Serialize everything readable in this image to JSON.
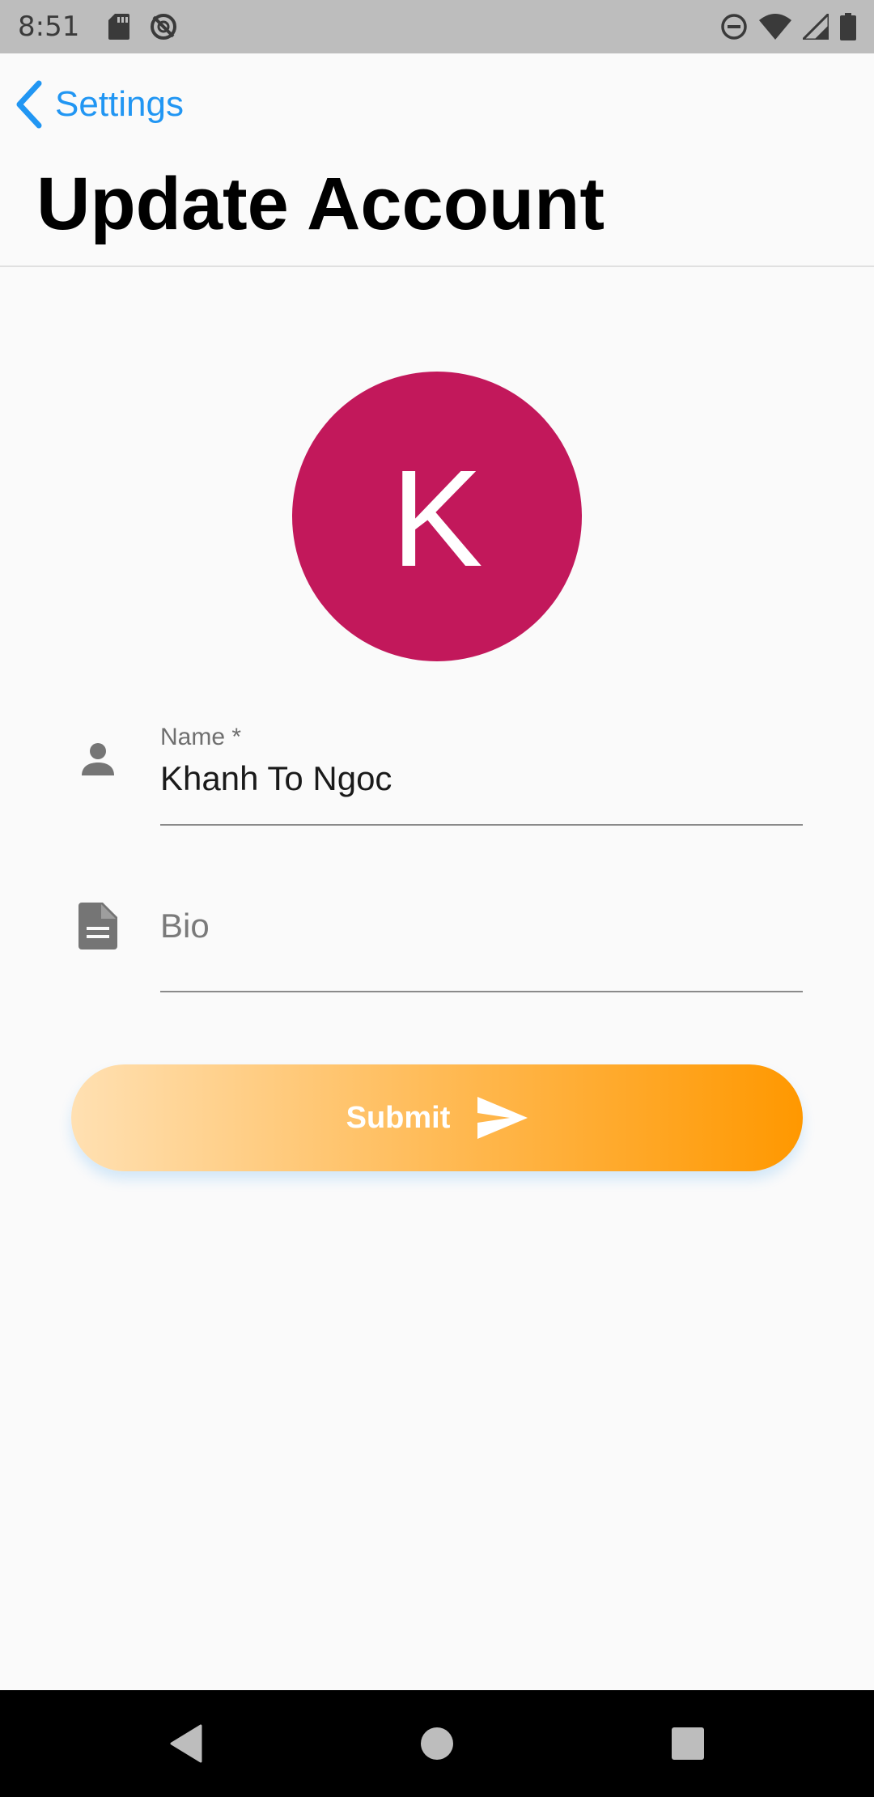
{
  "status_bar": {
    "time": "8:51",
    "left_icons": [
      "sd-card-icon",
      "no-sync-icon"
    ],
    "right_icons": [
      "do-not-disturb-icon",
      "wifi-icon",
      "cell-signal-icon",
      "battery-icon"
    ]
  },
  "header": {
    "back_label": "Settings",
    "title": "Update Account"
  },
  "avatar": {
    "initial": "K",
    "color": "#c2185b"
  },
  "form": {
    "name": {
      "label": "Name *",
      "value": "Khanh To Ngoc",
      "icon": "person-icon"
    },
    "bio": {
      "placeholder": "Bio",
      "value": "",
      "icon": "document-icon"
    },
    "submit_label": "Submit",
    "submit_icon": "send-icon"
  },
  "nav_bar": {
    "buttons": [
      "back-icon",
      "home-icon",
      "recents-icon"
    ]
  },
  "colors": {
    "accent": "#2196f3",
    "status_bar": "#bdbdbd",
    "button_gradient_start": "#ffe0b2",
    "button_gradient_end": "#ff9800"
  }
}
